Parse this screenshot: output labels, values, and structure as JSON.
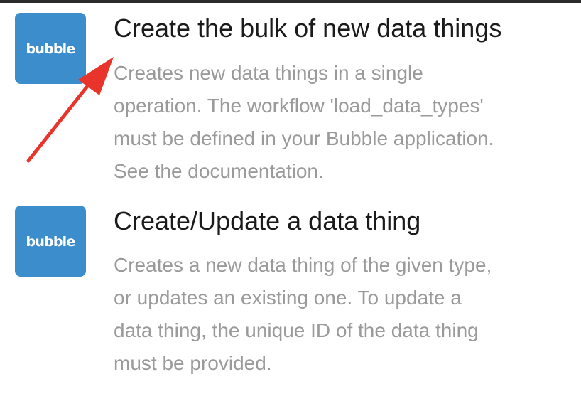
{
  "actions": [
    {
      "icon_name": "bubble-logo-icon",
      "icon_text": "bubble",
      "title": "Create the bulk of new data things",
      "description_lines": [
        "Creates new data things in a single",
        "operation. The workflow 'load_data_types'",
        "must be defined in your Bubble application.",
        "See the documentation."
      ]
    },
    {
      "icon_name": "bubble-logo-icon",
      "icon_text": "bubble",
      "title": "Create/Update a data thing",
      "description_lines": [
        "Creates a new data thing of the given type,",
        "or updates an existing one. To update a",
        "data thing, the unique ID of the data thing",
        "must be provided."
      ]
    }
  ],
  "colors": {
    "icon_background": "#3c8dcc",
    "title_text": "#1a1a1a",
    "description_text": "#9a9a9a",
    "annotation_arrow": "#e8342a"
  }
}
